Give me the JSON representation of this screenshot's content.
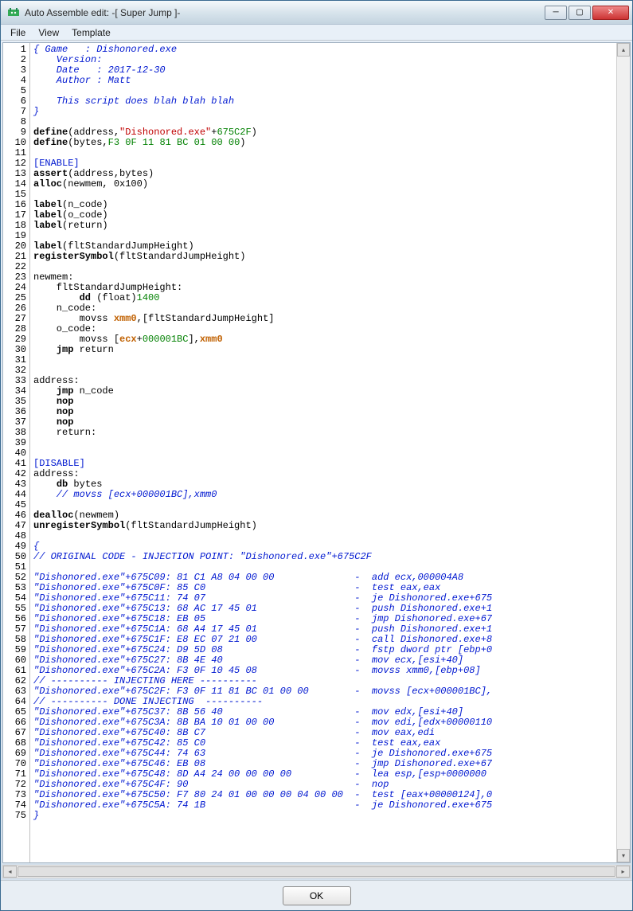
{
  "window": {
    "title": "Auto Assemble edit: -[  Super Jump  ]-"
  },
  "menu": {
    "file": "File",
    "view": "View",
    "template": "Template"
  },
  "buttons": {
    "ok": "OK"
  },
  "code": {
    "line_count": 75,
    "lines": [
      {
        "t": "comment",
        "x": "{ Game   : Dishonored.exe"
      },
      {
        "t": "comment",
        "x": "    Version:"
      },
      {
        "t": "comment",
        "x": "    Date   : 2017-12-30"
      },
      {
        "t": "comment",
        "x": "    Author : Matt"
      },
      {
        "t": "blank",
        "x": ""
      },
      {
        "t": "comment",
        "x": "    This script does blah blah blah"
      },
      {
        "t": "comment",
        "x": "}"
      },
      {
        "t": "blank",
        "x": ""
      },
      {
        "t": "define1",
        "kw": "define",
        "arg": "address",
        "str": "\"Dishonored.exe\"",
        "num": "675C2F"
      },
      {
        "t": "define2",
        "kw": "define",
        "arg": "bytes",
        "num": "F3 0F 11 81 BC 01 00 00"
      },
      {
        "t": "blank",
        "x": ""
      },
      {
        "t": "section",
        "x": "[ENABLE]"
      },
      {
        "t": "call2",
        "kw": "assert",
        "x": "(address,bytes)"
      },
      {
        "t": "call2",
        "kw": "alloc",
        "x": "(newmem, 0x100)"
      },
      {
        "t": "blank",
        "x": ""
      },
      {
        "t": "call2",
        "kw": "label",
        "x": "(n_code)"
      },
      {
        "t": "call2",
        "kw": "label",
        "x": "(o_code)"
      },
      {
        "t": "call2",
        "kw": "label",
        "x": "(return)"
      },
      {
        "t": "blank",
        "x": ""
      },
      {
        "t": "call2",
        "kw": "label",
        "x": "(fltStandardJumpHeight)"
      },
      {
        "t": "call2",
        "kw": "registerSymbol",
        "x": "(fltStandardJumpHeight)"
      },
      {
        "t": "blank",
        "x": ""
      },
      {
        "t": "plain",
        "x": "newmem:"
      },
      {
        "t": "plain",
        "x": "    fltStandardJumpHeight:"
      },
      {
        "t": "dd",
        "kw": "dd",
        "x": " (float)",
        "num": "1400"
      },
      {
        "t": "plain",
        "x": "    n_code:"
      },
      {
        "t": "movss1",
        "x1": "        movss ",
        "reg": "xmm0",
        "x2": ",[fltStandardJumpHeight]"
      },
      {
        "t": "plain",
        "x": "    o_code:"
      },
      {
        "t": "movss2",
        "x1": "        movss [",
        "reg1": "ecx",
        "num": "000001BC",
        "x2": "],",
        "reg2": "xmm0"
      },
      {
        "t": "jmp",
        "kw": "jmp",
        "x": " return"
      },
      {
        "t": "blank",
        "x": ""
      },
      {
        "t": "blank",
        "x": ""
      },
      {
        "t": "plain",
        "x": "address:"
      },
      {
        "t": "jmp",
        "kw": "jmp",
        "x": " n_code"
      },
      {
        "t": "kwonly",
        "kw": "nop"
      },
      {
        "t": "kwonly",
        "kw": "nop"
      },
      {
        "t": "kwonly",
        "kw": "nop"
      },
      {
        "t": "plain",
        "x": "    return:"
      },
      {
        "t": "blank",
        "x": ""
      },
      {
        "t": "blank",
        "x": ""
      },
      {
        "t": "section",
        "x": "[DISABLE]"
      },
      {
        "t": "plain",
        "x": "address:"
      },
      {
        "t": "db",
        "kw": "db",
        "x": " bytes"
      },
      {
        "t": "comment",
        "x": "    // movss [ecx+000001BC],xmm0"
      },
      {
        "t": "blank",
        "x": ""
      },
      {
        "t": "call2",
        "kw": "dealloc",
        "x": "(newmem)"
      },
      {
        "t": "call2",
        "kw": "unregisterSymbol",
        "x": "(fltStandardJumpHeight)"
      },
      {
        "t": "blank",
        "x": ""
      },
      {
        "t": "comment",
        "x": "{"
      },
      {
        "t": "comment",
        "x": "// ORIGINAL CODE - INJECTION POINT: \"Dishonored.exe\"+675C2F"
      },
      {
        "t": "blank",
        "x": ""
      },
      {
        "t": "comment",
        "x": "\"Dishonored.exe\"+675C09: 81 C1 A8 04 00 00              -  add ecx,000004A8"
      },
      {
        "t": "comment",
        "x": "\"Dishonored.exe\"+675C0F: 85 C0                          -  test eax,eax"
      },
      {
        "t": "comment",
        "x": "\"Dishonored.exe\"+675C11: 74 07                          -  je Dishonored.exe+675"
      },
      {
        "t": "comment",
        "x": "\"Dishonored.exe\"+675C13: 68 AC 17 45 01                 -  push Dishonored.exe+1"
      },
      {
        "t": "comment",
        "x": "\"Dishonored.exe\"+675C18: EB 05                          -  jmp Dishonored.exe+67"
      },
      {
        "t": "comment",
        "x": "\"Dishonored.exe\"+675C1A: 68 A4 17 45 01                 -  push Dishonored.exe+1"
      },
      {
        "t": "comment",
        "x": "\"Dishonored.exe\"+675C1F: E8 EC 07 21 00                 -  call Dishonored.exe+8"
      },
      {
        "t": "comment",
        "x": "\"Dishonored.exe\"+675C24: D9 5D 08                       -  fstp dword ptr [ebp+0"
      },
      {
        "t": "comment",
        "x": "\"Dishonored.exe\"+675C27: 8B 4E 40                       -  mov ecx,[esi+40]"
      },
      {
        "t": "comment",
        "x": "\"Dishonored.exe\"+675C2A: F3 0F 10 45 08                 -  movss xmm0,[ebp+08]"
      },
      {
        "t": "comment",
        "x": "// ---------- INJECTING HERE ----------"
      },
      {
        "t": "comment",
        "x": "\"Dishonored.exe\"+675C2F: F3 0F 11 81 BC 01 00 00        -  movss [ecx+000001BC],"
      },
      {
        "t": "comment",
        "x": "// ---------- DONE INJECTING  ----------"
      },
      {
        "t": "comment",
        "x": "\"Dishonored.exe\"+675C37: 8B 56 40                       -  mov edx,[esi+40]"
      },
      {
        "t": "comment",
        "x": "\"Dishonored.exe\"+675C3A: 8B BA 10 01 00 00              -  mov edi,[edx+00000110"
      },
      {
        "t": "comment",
        "x": "\"Dishonored.exe\"+675C40: 8B C7                          -  mov eax,edi"
      },
      {
        "t": "comment",
        "x": "\"Dishonored.exe\"+675C42: 85 C0                          -  test eax,eax"
      },
      {
        "t": "comment",
        "x": "\"Dishonored.exe\"+675C44: 74 63                          -  je Dishonored.exe+675"
      },
      {
        "t": "comment",
        "x": "\"Dishonored.exe\"+675C46: EB 08                          -  jmp Dishonored.exe+67"
      },
      {
        "t": "comment",
        "x": "\"Dishonored.exe\"+675C48: 8D A4 24 00 00 00 00           -  lea esp,[esp+0000000"
      },
      {
        "t": "comment",
        "x": "\"Dishonored.exe\"+675C4F: 90                             -  nop"
      },
      {
        "t": "comment",
        "x": "\"Dishonored.exe\"+675C50: F7 80 24 01 00 00 00 04 00 00  -  test [eax+00000124],0"
      },
      {
        "t": "comment",
        "x": "\"Dishonored.exe\"+675C5A: 74 1B                          -  je Dishonored.exe+675"
      },
      {
        "t": "comment",
        "x": "}"
      }
    ]
  }
}
